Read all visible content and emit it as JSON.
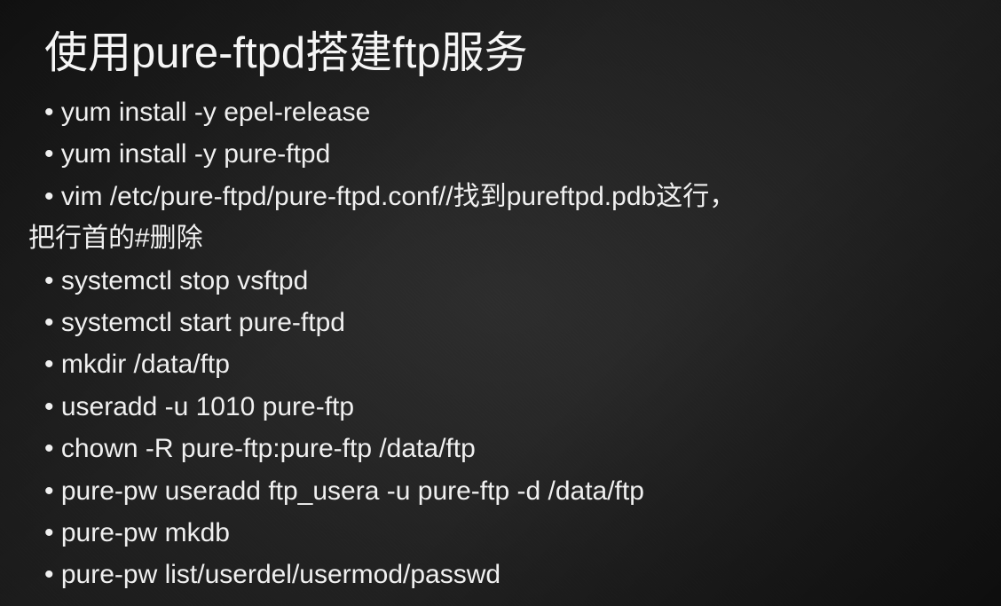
{
  "title": "使用pure-ftpd搭建ftp服务",
  "items": [
    " yum install -y epel-release",
    "yum install -y pure-ftpd",
    "vim /etc/pure-ftpd/pure-ftpd.conf//找到pureftpd.pdb这行，",
    "systemctl stop vsftpd",
    "systemctl start pure-ftpd",
    "mkdir /data/ftp",
    "useradd -u 1010 pure-ftp",
    "chown -R pure-ftp:pure-ftp /data/ftp",
    "pure-pw useradd ftp_usera -u pure-ftp  -d /data/ftp",
    "pure-pw mkdb",
    "pure-pw list/userdel/usermod/passwd"
  ],
  "continuation": "把行首的#删除"
}
